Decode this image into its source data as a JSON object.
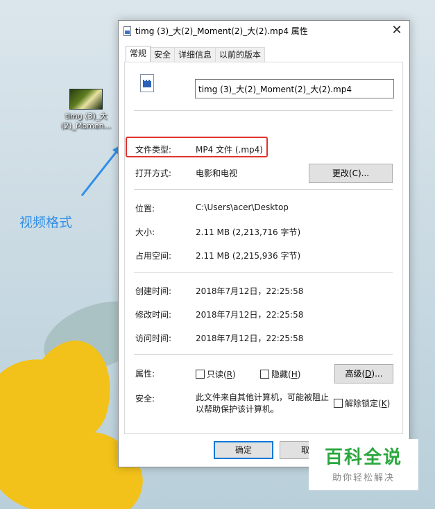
{
  "desktop": {
    "icon_label": "timg (3)_大(2)_Momen...",
    "annotation": "视频格式"
  },
  "dialog": {
    "title": "timg (3)_大(2)_Moment(2)_大(2).mp4 属性",
    "close_glyph": "✕",
    "tabs": [
      "常规",
      "安全",
      "详细信息",
      "以前的版本"
    ],
    "active_tab": "常规",
    "filename_value": "timg (3)_大(2)_Moment(2)_大(2).mp4",
    "file_type_label": "文件类型:",
    "file_type_value": "MP4 文件 (.mp4)",
    "open_with_label": "打开方式:",
    "open_with_value": "电影和电视",
    "change_button": "更改(C)...",
    "location_label": "位置:",
    "location_value": "C:\\Users\\acer\\Desktop",
    "size_label": "大小:",
    "size_value": "2.11 MB (2,213,716 字节)",
    "size_on_disk_label": "占用空间:",
    "size_on_disk_value": "2.11 MB (2,215,936 字节)",
    "created_label": "创建时间:",
    "created_value": "2018年7月12日，22:25:58",
    "modified_label": "修改时间:",
    "modified_value": "2018年7月12日，22:25:58",
    "accessed_label": "访问时间:",
    "accessed_value": "2018年7月12日，22:25:58",
    "attributes_label": "属性:",
    "readonly_prefix": "只读(",
    "readonly_key": "R",
    "readonly_suffix": ")",
    "hidden_prefix": "隐藏(",
    "hidden_key": "H",
    "hidden_suffix": ")",
    "advanced_prefix": "高级(",
    "advanced_key": "D",
    "advanced_suffix": ")...",
    "security_label": "安全:",
    "security_text_line1": "此文件来自其他计算机，可能被阻止",
    "security_text_line2": "以帮助保护该计算机。",
    "unblock_prefix": "解除锁定(",
    "unblock_key": "K",
    "unblock_suffix": ")",
    "ok_button": "确定",
    "cancel_button_partial": "取"
  },
  "watermark": {
    "title": "百科全说",
    "subtitle": "助你轻松解决"
  },
  "colors": {
    "highlight_border": "#e0332e",
    "annotation_blue": "#2f8fe8",
    "watermark_green": "#2aa83e"
  }
}
